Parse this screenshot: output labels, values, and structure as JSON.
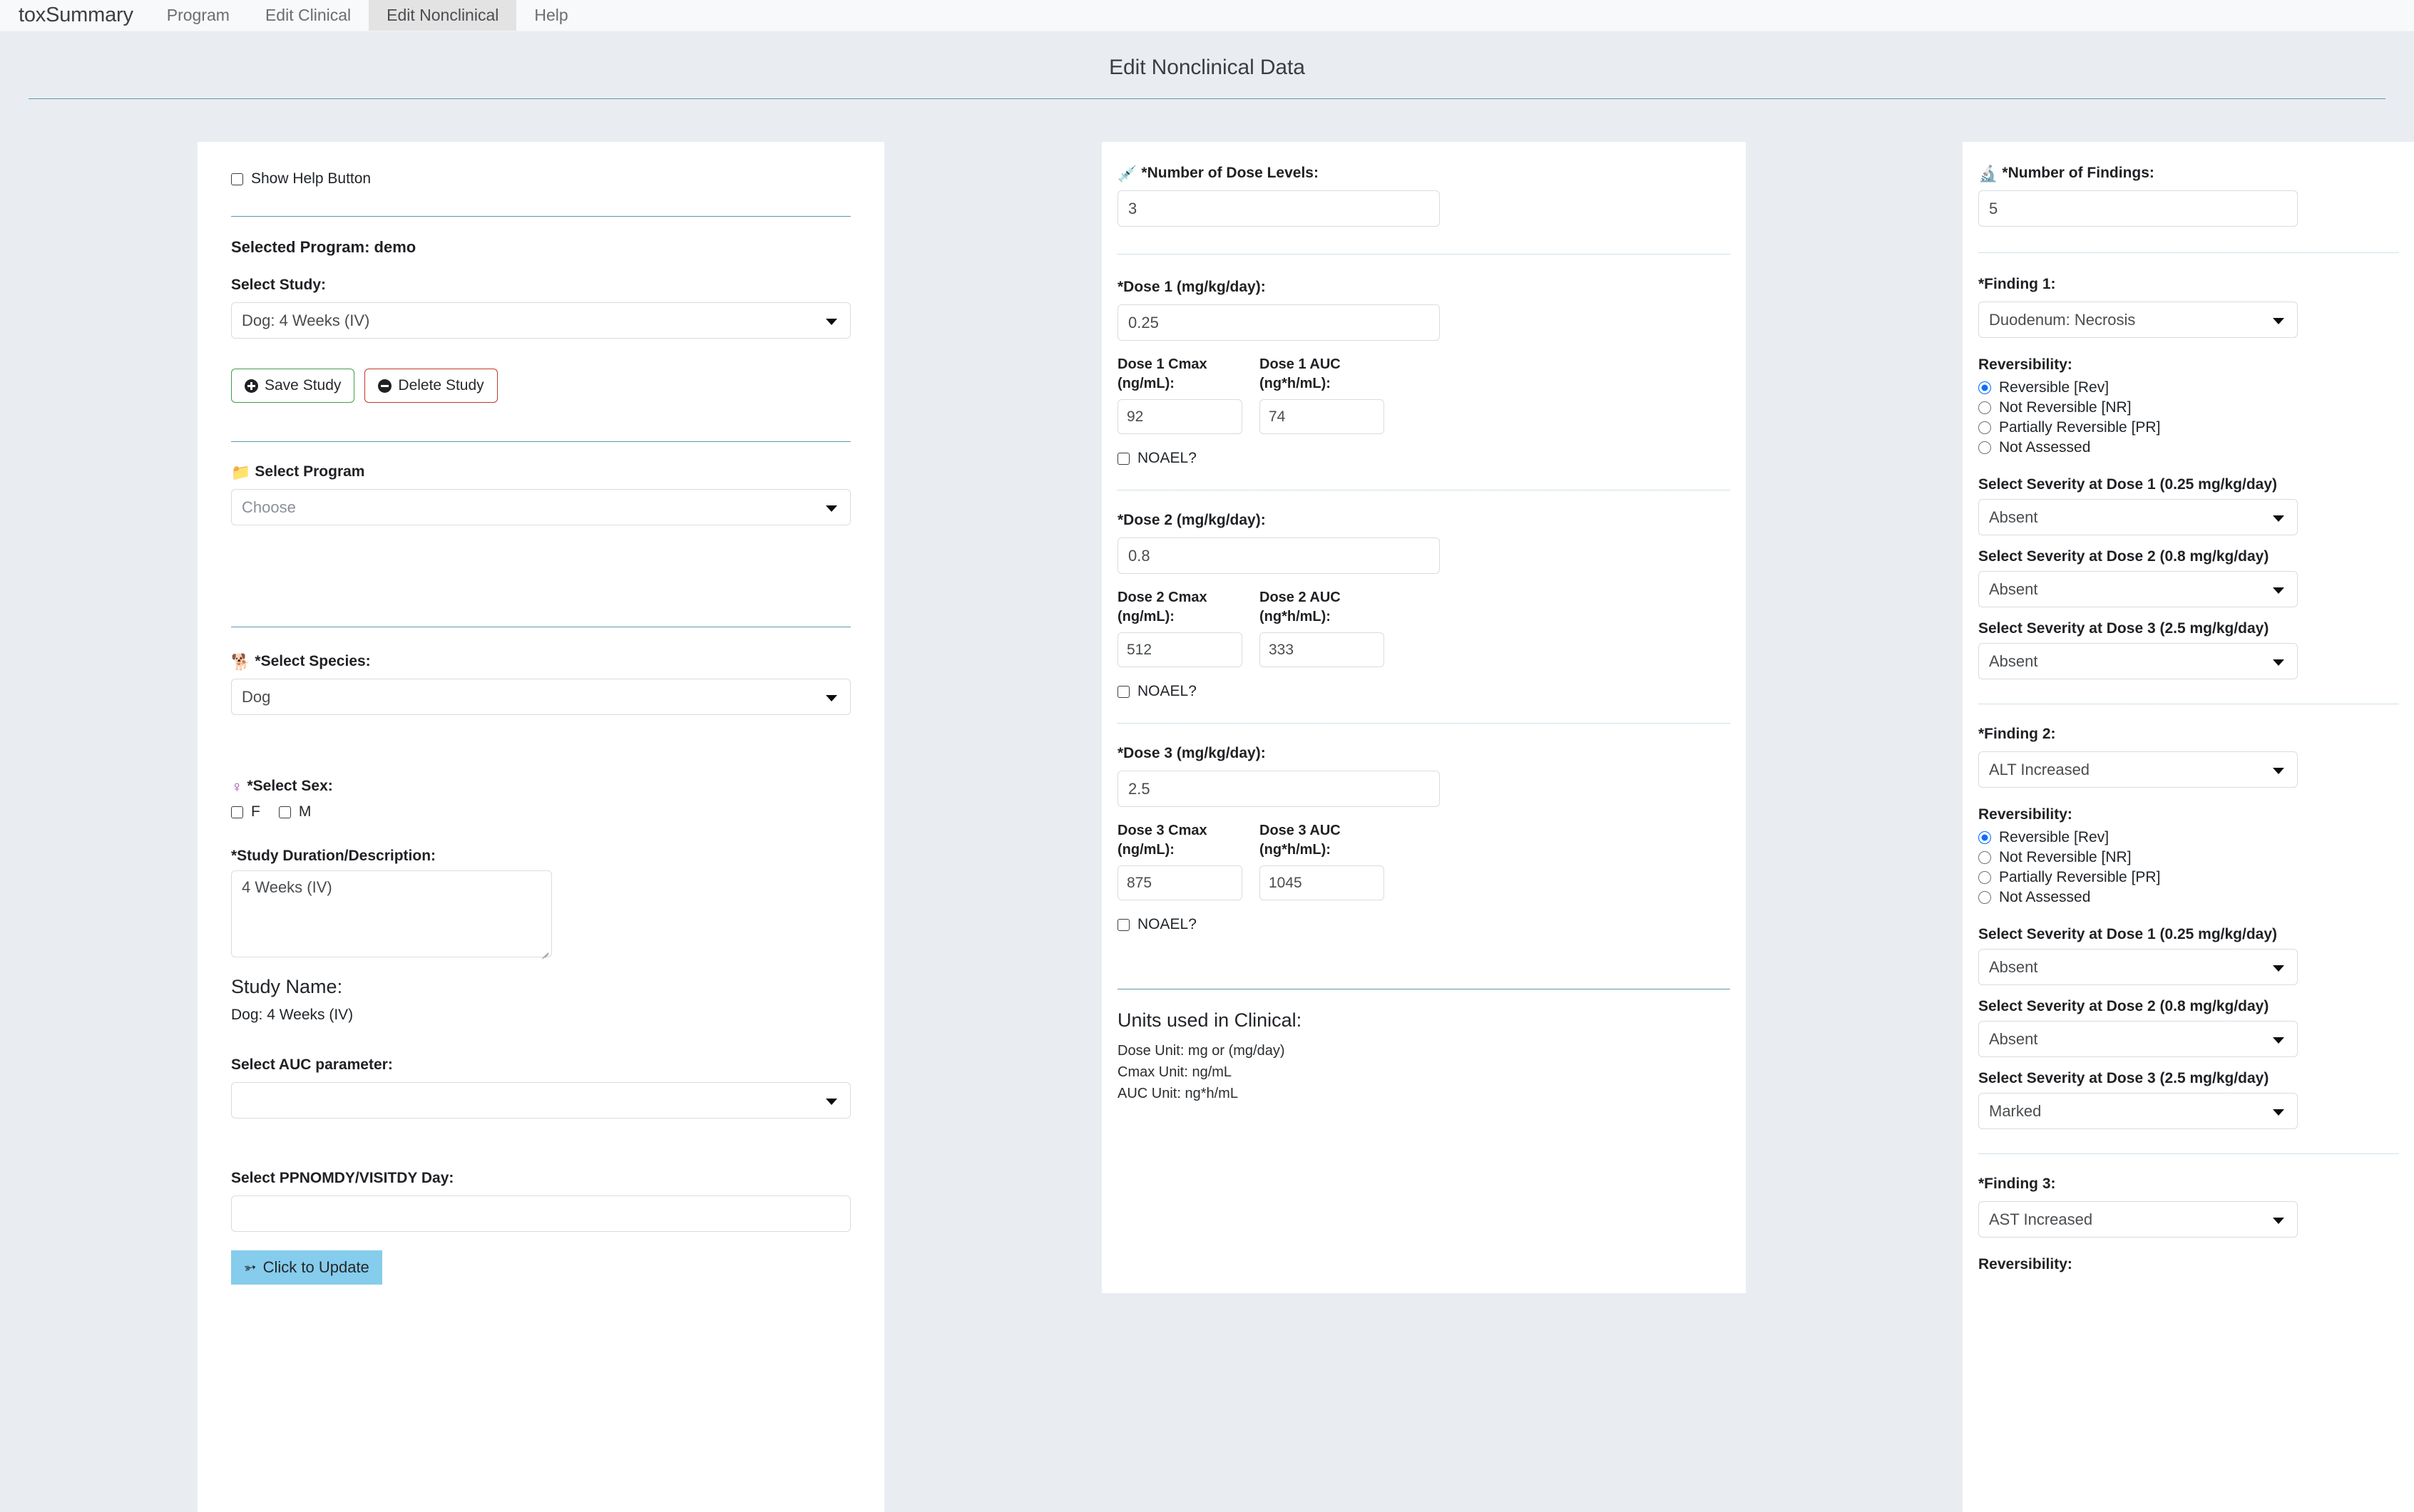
{
  "nav": {
    "brand": "toxSummary",
    "items": [
      {
        "label": "Program",
        "active": false
      },
      {
        "label": "Edit Clinical",
        "active": false
      },
      {
        "label": "Edit Nonclinical",
        "active": true
      },
      {
        "label": "Help",
        "active": false
      }
    ]
  },
  "header": {
    "title": "Edit Nonclinical Data"
  },
  "left": {
    "show_help_label": "Show Help Button",
    "selected_program": "Selected Program: demo",
    "select_study_label": "Select Study:",
    "select_study_value": "Dog: 4 Weeks (IV)",
    "save_study_label": "Save Study",
    "delete_study_label": "Delete Study",
    "select_program_label": "Select Program",
    "select_program_value": "Choose",
    "select_species_label": "*Select Species:",
    "select_species_value": "Dog",
    "select_sex_label": "*Select Sex:",
    "sex_options": [
      "F",
      "M"
    ],
    "study_duration_label": "*Study Duration/Description:",
    "study_duration_value": "4 Weeks (IV)",
    "study_name_label": "Study Name:",
    "study_name_value": "Dog: 4 Weeks (IV)",
    "auc_param_label": "Select AUC parameter:",
    "auc_param_value": "",
    "ppnomdy_label": "Select PPNOMDY/VISITDY Day:",
    "ppnomdy_value": "",
    "update_button_label": "Click to Update"
  },
  "middle": {
    "num_dose_levels_label": "*Number of Dose Levels:",
    "num_dose_levels_value": "3",
    "doses": [
      {
        "dose_label": "*Dose 1 (mg/kg/day):",
        "dose_value": "0.25",
        "cmax_label": "Dose 1 Cmax (ng/mL):",
        "cmax_value": "92",
        "auc_label": "Dose 1 AUC (ng*h/mL):",
        "auc_value": "74",
        "noael_label": "NOAEL?"
      },
      {
        "dose_label": "*Dose 2 (mg/kg/day):",
        "dose_value": "0.8",
        "cmax_label": "Dose 2 Cmax (ng/mL):",
        "cmax_value": "512",
        "auc_label": "Dose 2 AUC (ng*h/mL):",
        "auc_value": "333",
        "noael_label": "NOAEL?"
      },
      {
        "dose_label": "*Dose 3 (mg/kg/day):",
        "dose_value": "2.5",
        "cmax_label": "Dose 3 Cmax (ng/mL):",
        "cmax_value": "875",
        "auc_label": "Dose 3 AUC (ng*h/mL):",
        "auc_value": "1045",
        "noael_label": "NOAEL?"
      }
    ],
    "units_title": "Units used in Clinical:",
    "units_lines": [
      "Dose Unit: mg or (mg/day)",
      "Cmax Unit: ng/mL",
      "AUC Unit: ng*h/mL"
    ]
  },
  "right": {
    "num_findings_label": "*Number of Findings:",
    "num_findings_value": "5",
    "reversibility_label": "Reversibility:",
    "reversibility_options": [
      "Reversible [Rev]",
      "Not Reversible [NR]",
      "Partially Reversible [PR]",
      "Not Assessed"
    ],
    "findings": [
      {
        "label": "*Finding 1:",
        "value": "Duodenum: Necrosis",
        "reversibility_selected": 0,
        "severities": [
          {
            "label": "Select Severity at Dose 1 (0.25 mg/kg/day)",
            "value": "Absent"
          },
          {
            "label": "Select Severity at Dose 2 (0.8 mg/kg/day)",
            "value": "Absent"
          },
          {
            "label": "Select Severity at Dose 3 (2.5 mg/kg/day)",
            "value": "Absent"
          }
        ]
      },
      {
        "label": "*Finding 2:",
        "value": "ALT Increased",
        "reversibility_selected": 0,
        "severities": [
          {
            "label": "Select Severity at Dose 1 (0.25 mg/kg/day)",
            "value": "Absent"
          },
          {
            "label": "Select Severity at Dose 2 (0.8 mg/kg/day)",
            "value": "Absent"
          },
          {
            "label": "Select Severity at Dose 3 (2.5 mg/kg/day)",
            "value": "Marked"
          }
        ]
      },
      {
        "label": "*Finding 3:",
        "value": "AST Increased",
        "reversibility_selected": 0,
        "severities": []
      }
    ]
  },
  "colors": {
    "page_bg": "#e9edf2",
    "panel_bg": "#ffffff",
    "rule_teal": "#5a9aae",
    "nav_bg": "#f8f9fa",
    "nav_active_bg": "#e3e3e3",
    "accent_blue": "#0d6efd",
    "save_green": "#3f9e4d",
    "delete_red": "#c0392b",
    "update_button": "#86ccec"
  }
}
